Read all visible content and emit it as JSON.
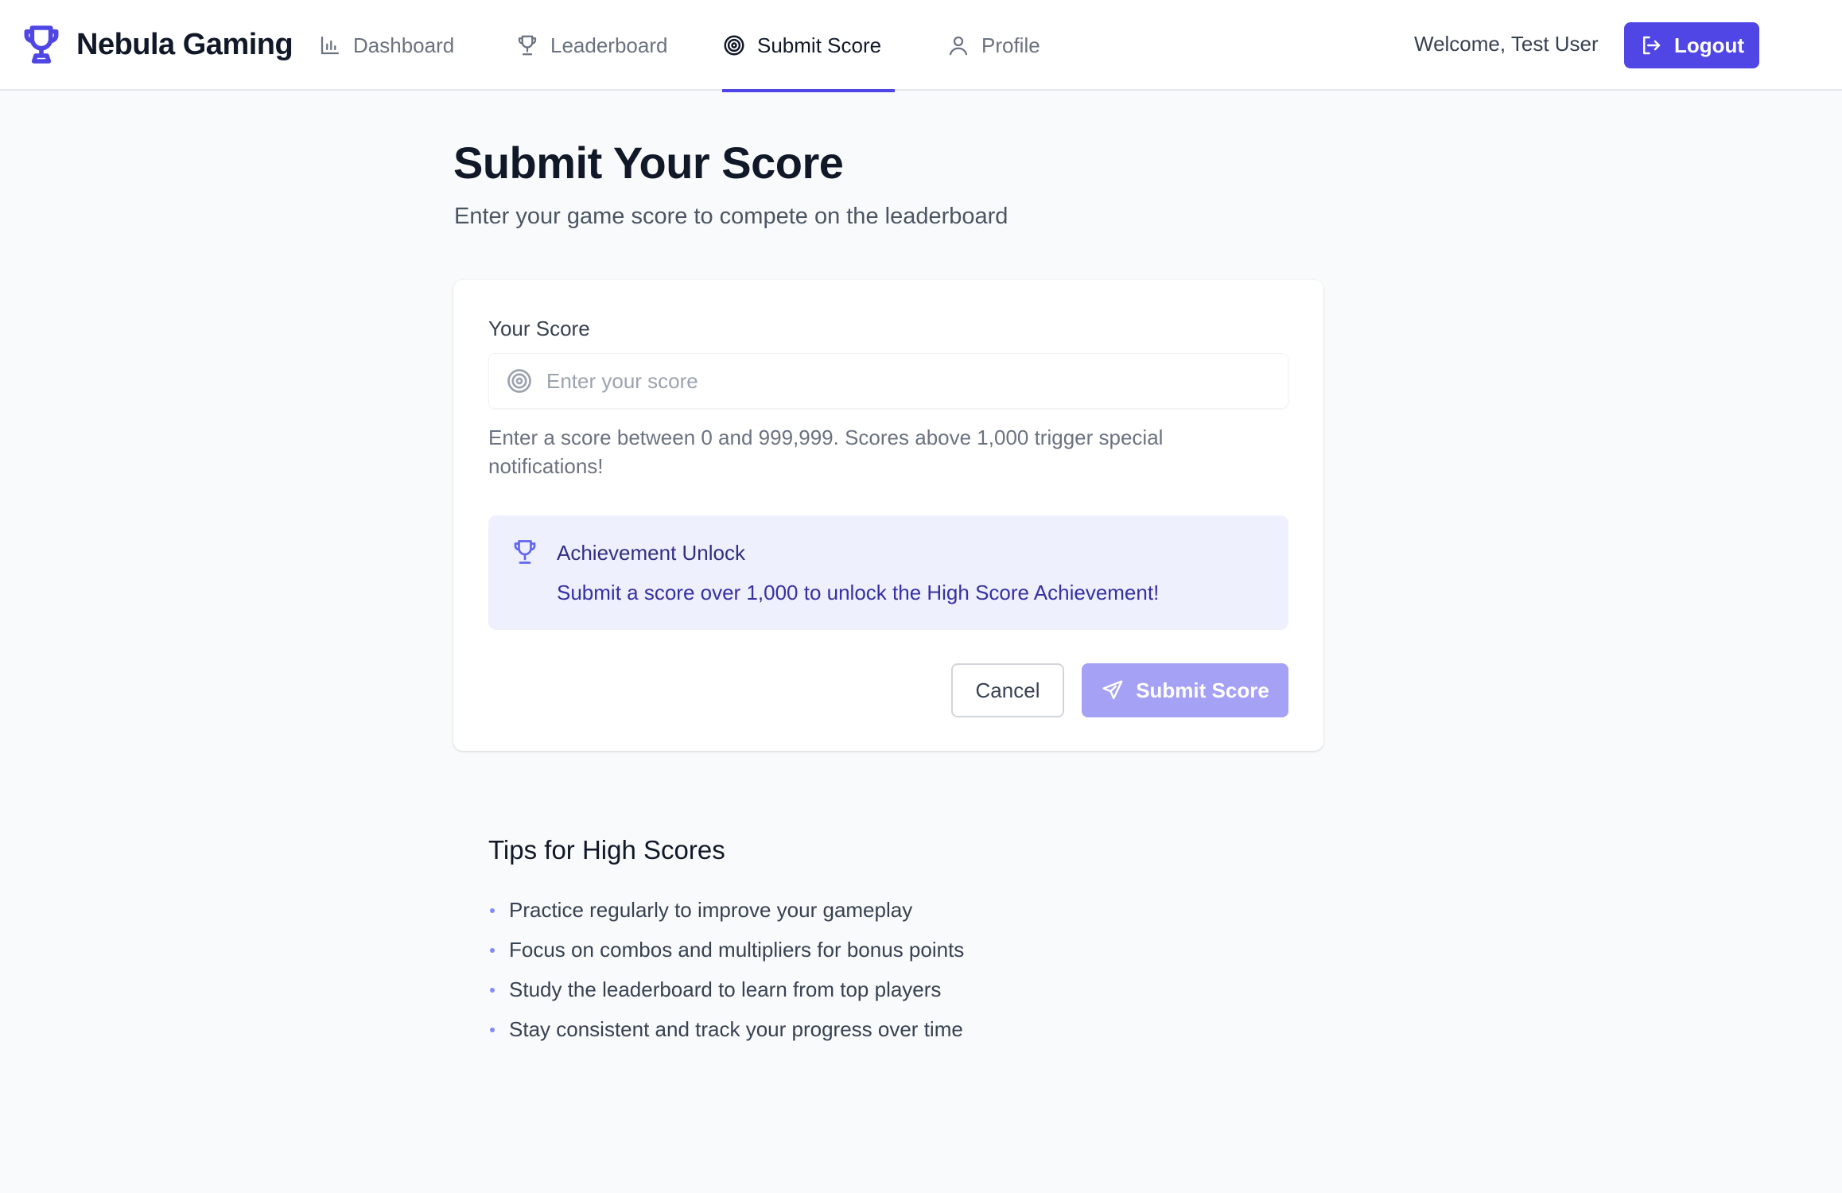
{
  "app": {
    "brand": "Nebula Gaming",
    "accent_color": "#4f46e5",
    "brand_icon": "trophy-icon"
  },
  "nav": {
    "items": [
      {
        "label": "Dashboard",
        "icon": "bar-chart-icon",
        "active": false
      },
      {
        "label": "Leaderboard",
        "icon": "trophy-icon",
        "active": false
      },
      {
        "label": "Submit Score",
        "icon": "target-icon",
        "active": true
      },
      {
        "label": "Profile",
        "icon": "user-icon",
        "active": false
      }
    ]
  },
  "header": {
    "welcome": "Welcome, Test User",
    "logout_label": "Logout",
    "logout_icon": "logout-icon"
  },
  "page": {
    "title": "Submit Your Score",
    "subtitle": "Enter your game score to compete on the leaderboard"
  },
  "form": {
    "score_label": "Your Score",
    "score_value": "",
    "score_placeholder": "Enter your score",
    "score_icon": "target-icon",
    "help_text": "Enter a score between 0 and 999,999. Scores above 1,000 trigger special notifications!",
    "achievement": {
      "icon": "trophy-icon",
      "title": "Achievement Unlock",
      "text": "Submit a score over 1,000 to unlock the High Score Achievement!"
    },
    "cancel_label": "Cancel",
    "submit_label": "Submit Score",
    "submit_icon": "send-icon"
  },
  "tips": {
    "title": "Tips for High Scores",
    "items": [
      "Practice regularly to improve your gameplay",
      "Focus on combos and multipliers for bonus points",
      "Study the leaderboard to learn from top players",
      "Stay consistent and track your progress over time"
    ]
  }
}
